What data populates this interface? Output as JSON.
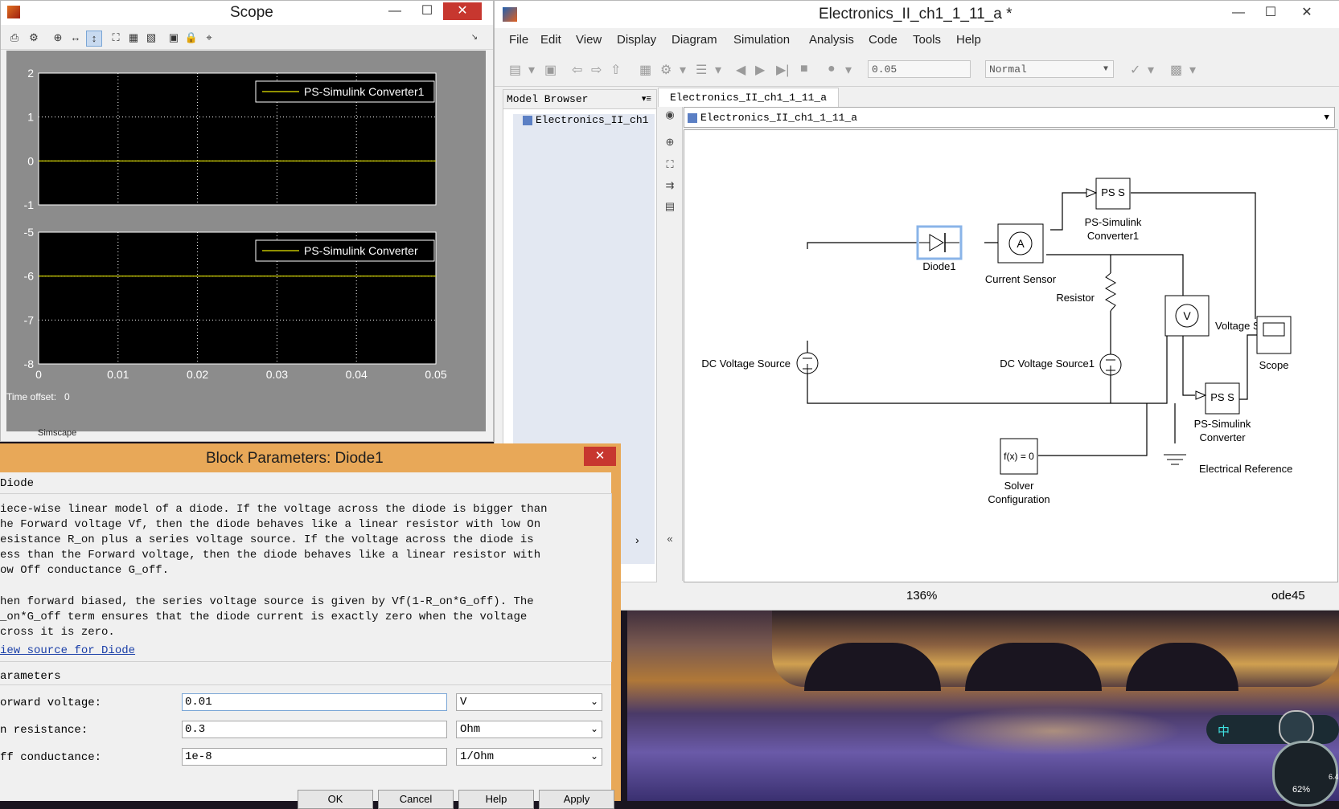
{
  "scope": {
    "title": "Scope",
    "minimize": "—",
    "maximize": "☐",
    "close": "✕",
    "time_offset_label": "Time offset:",
    "time_offset_value": "0",
    "partial_label": "Simscape"
  },
  "chart_data": [
    {
      "type": "line",
      "title": "",
      "xlabel": "",
      "ylabel": "",
      "xlim": [
        0,
        0.05
      ],
      "ylim": [
        -1,
        2
      ],
      "y_ticks": [
        "2",
        "1",
        "0",
        "-1"
      ],
      "grid": true,
      "legend": "top-right",
      "series": [
        {
          "name": "PS-Simulink Converter1",
          "x": [
            0,
            0.05
          ],
          "values": [
            0,
            0
          ],
          "color": "#e6e600"
        }
      ]
    },
    {
      "type": "line",
      "title": "",
      "xlabel": "",
      "ylabel": "",
      "xlim": [
        0,
        0.05
      ],
      "ylim": [
        -8,
        -5
      ],
      "y_ticks": [
        "-5",
        "-6",
        "-7",
        "-8"
      ],
      "x_ticks": [
        "0",
        "0.01",
        "0.02",
        "0.03",
        "0.04",
        "0.05"
      ],
      "grid": true,
      "legend": "top-right",
      "series": [
        {
          "name": "PS-Simulink Converter",
          "x": [
            0,
            0.05
          ],
          "values": [
            -6,
            -6
          ],
          "color": "#e6e600"
        }
      ]
    }
  ],
  "simulink": {
    "title": "Electronics_II_ch1_1_11_a *",
    "minimize": "—",
    "maximize": "☐",
    "close": "✕",
    "menu": [
      "File",
      "Edit",
      "View",
      "Display",
      "Diagram",
      "Simulation",
      "Analysis",
      "Code",
      "Tools",
      "Help"
    ],
    "stop_time": "0.05",
    "sim_mode": "Normal",
    "model_browser_label": "Model Browser",
    "browser_item": "Electronics_II_ch1",
    "tab": "Electronics_II_ch1_1_11_a",
    "address": "Electronics_II_ch1_1_11_a",
    "zoom": "136%",
    "solver": "ode45",
    "blocks": {
      "diode": "Diode1",
      "current_sensor": "Current Sensor",
      "ps_conv1_line1": "PS-Simulink",
      "ps_conv1_line2": "Converter1",
      "ps_conv_line1": "PS-Simulink",
      "ps_conv_line2": "Converter",
      "resistor": "Resistor",
      "voltage_sensor": "Voltage Sensor",
      "scope": "Scope",
      "dc_source": "DC Voltage Source",
      "dc_source1": "DC Voltage Source1",
      "solver_line1": "Solver",
      "solver_line2": "Configuration",
      "solver_body": "f(x) = 0",
      "elec_ref": "Electrical Reference",
      "ps_s": "PS S",
      "ammeter": "A",
      "voltmeter": "V"
    }
  },
  "dialog": {
    "title": "Block Parameters: Diode1",
    "close": "✕",
    "section": "Diode",
    "desc_lines": [
      "iece-wise linear model of a diode. If the voltage across the diode is bigger than",
      "he Forward voltage Vf, then the diode behaves like a linear resistor with low On",
      "esistance R_on plus a series voltage source. If the voltage across the diode is",
      "ess than the Forward voltage, then the diode behaves like a linear resistor with",
      "ow Off conductance G_off."
    ],
    "desc2_lines": [
      "hen forward biased, the series voltage source is given by Vf(1-R_on*G_off). The",
      "_on*G_off term ensures that the diode current is exactly zero when the voltage",
      "cross it is zero."
    ],
    "link": "iew source for Diode",
    "params_label": "arameters",
    "params": [
      {
        "label": "orward voltage:",
        "value": "0.01",
        "unit": "V"
      },
      {
        "label": "n resistance:",
        "value": "0.3",
        "unit": "Ohm"
      },
      {
        "label": "ff conductance:",
        "value": "1e-8",
        "unit": "1/Ohm"
      }
    ],
    "buttons": [
      "OK",
      "Cancel",
      "Help",
      "Apply"
    ]
  },
  "tray": {
    "ime_label": "中",
    "speed_percent": "62%",
    "net_rate": "6.4"
  }
}
